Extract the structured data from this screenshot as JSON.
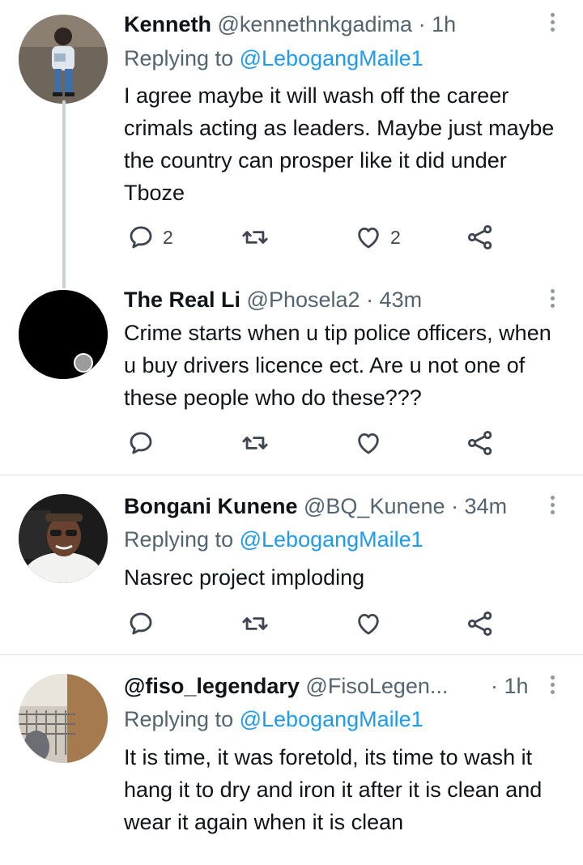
{
  "tweets": [
    {
      "name": "Kenneth",
      "handle": "@kennethnkgadima",
      "time": "· 1h",
      "replying_prefix": "Replying to",
      "replying_to": "@LebogangMaile1",
      "text": "I agree maybe it will wash off the career crimals acting as leaders. Maybe just maybe the country can prosper like it did under Tboze",
      "replies": "2",
      "retweets": "",
      "likes": "2"
    },
    {
      "name": "The Real Li",
      "handle": "@Phosela2",
      "time": "· 43m",
      "text": "Crime starts when u tip police officers, when u buy drivers licence ect. Are u not one of these people who do these???",
      "replies": "",
      "retweets": "",
      "likes": ""
    },
    {
      "name": "Bongani Kunene",
      "handle": "@BQ_Kunene",
      "time": "· 34m",
      "replying_prefix": "Replying to",
      "replying_to": "@LebogangMaile1",
      "text": "Nasrec project imploding",
      "replies": "",
      "retweets": "",
      "likes": ""
    },
    {
      "name": "@fiso_legendary",
      "handle": "@FisoLegen...",
      "time": "· 1h",
      "replying_prefix": "Replying to",
      "replying_to": "@LebogangMaile1",
      "text": "It is time, it was foretold, its time to wash it hang it to dry and iron it after it is clean and wear it again when it is clean"
    }
  ],
  "icons": {
    "reply": "reply-icon",
    "retweet": "retweet-icon",
    "like": "heart-icon",
    "share": "share-icon",
    "more": "more-vertical-icon"
  },
  "colors": {
    "link": "#1d9bf0",
    "muted": "#536471",
    "text": "#0f1419",
    "thread_line": "#c9d0d6",
    "divider": "#d9dde1"
  }
}
